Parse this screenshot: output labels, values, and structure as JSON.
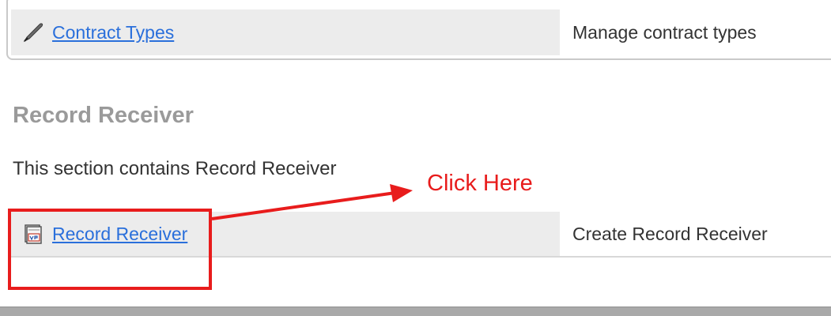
{
  "top_row": {
    "link_label": "Contract Types",
    "description": "Manage contract types"
  },
  "record_receiver_section": {
    "title": "Record Receiver",
    "description": "This section contains Record Receiver",
    "row": {
      "link_label": "Record Receiver",
      "description": "Create Record Receiver"
    }
  },
  "annotation": {
    "label": "Click Here",
    "color": "#e81c1c"
  },
  "icons": {
    "contract_types": "quill-pen-icon",
    "record_receiver": "form-document-icon"
  },
  "colors": {
    "link": "#2a6fdb",
    "section_title": "#9a9a9a",
    "cell_background": "#ececec"
  }
}
